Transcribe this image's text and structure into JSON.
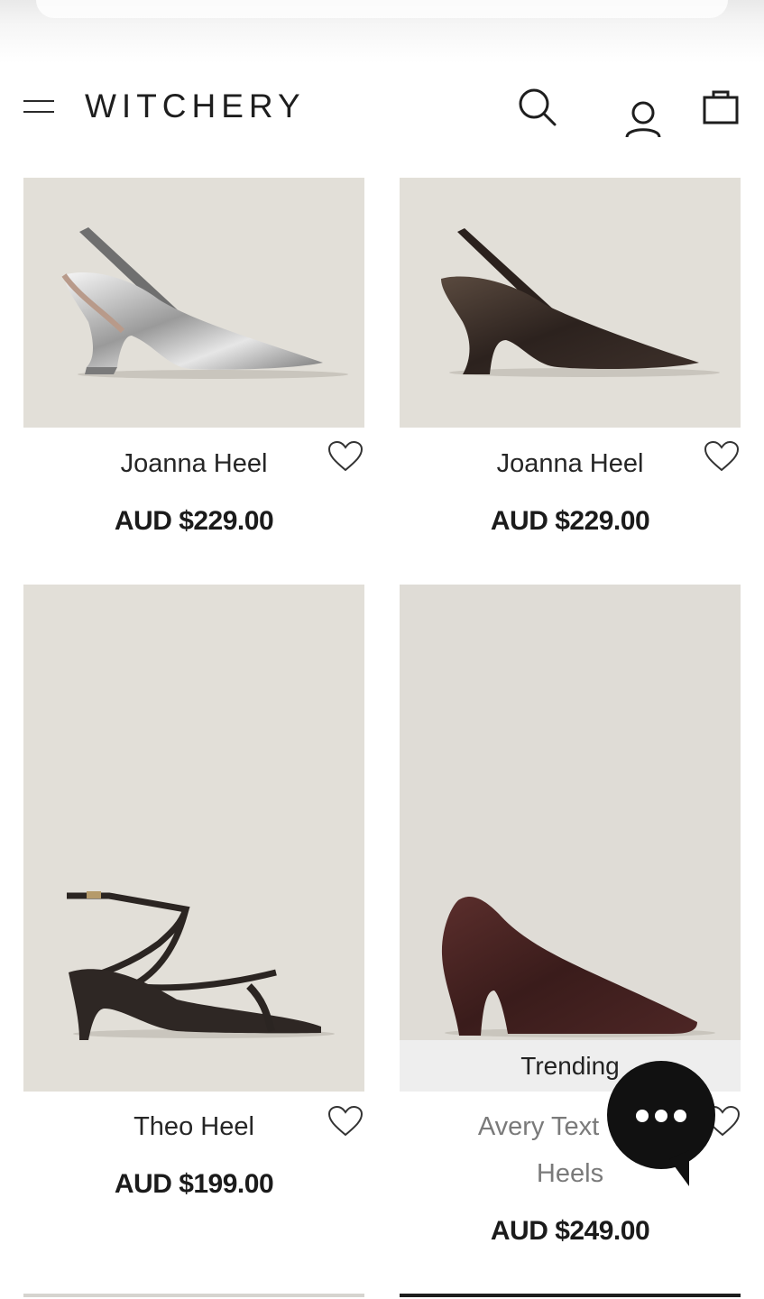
{
  "header": {
    "logo": "WITCHERY",
    "icons": [
      "menu-icon",
      "search-icon",
      "account-icon",
      "shopping-bag-icon"
    ]
  },
  "products": [
    {
      "name": "Joanna Heel",
      "price": "AUD $229.00",
      "image": "silver slingback heel"
    },
    {
      "name": "Joanna Heel",
      "price": "AUD $229.00",
      "image": "dark brown slingback heel"
    },
    {
      "name": "Theo Heel",
      "price": "AUD $199.00",
      "image": "strappy croc sandal heel"
    },
    {
      "name_line1": "Avery Text",
      "name_line2": "Heels",
      "price": "AUD $249.00",
      "badge": "Trending",
      "image": "burgundy textured pump"
    }
  ],
  "colors": {
    "image_bg": "#e2dfd8",
    "text": "#1b1b1b",
    "chat": "#111111"
  }
}
